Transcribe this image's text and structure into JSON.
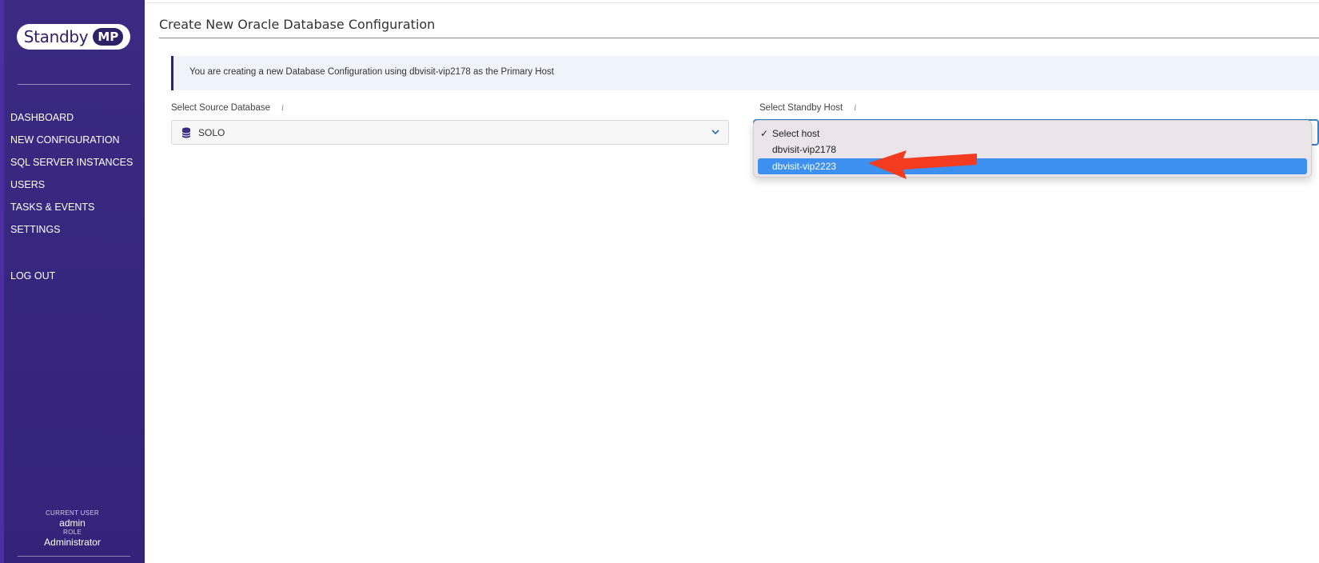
{
  "sidebar": {
    "logo": {
      "word": "Standby",
      "badge": "MP"
    },
    "items": [
      {
        "label": "DASHBOARD"
      },
      {
        "label": "NEW CONFIGURATION"
      },
      {
        "label": "SQL SERVER INSTANCES"
      },
      {
        "label": "USERS"
      },
      {
        "label": "TASKS & EVENTS"
      },
      {
        "label": "SETTINGS"
      }
    ],
    "logout_label": "LOG OUT",
    "user": {
      "current_user_caption": "CURRENT USER",
      "current_user": "admin",
      "role_caption": "ROLE",
      "role": "Administrator"
    }
  },
  "main": {
    "title": "Create New Oracle Database Configuration",
    "banner": "You are creating a new Database Configuration using dbvisit-vip2178 as the Primary Host",
    "source_db": {
      "label": "Select Source Database",
      "value": "SOLO",
      "icon": "database-icon"
    },
    "standby_host": {
      "label": "Select Standby Host",
      "options": [
        {
          "label": "Select host",
          "checked": true
        },
        {
          "label": "dbvisit-vip2178",
          "checked": false
        },
        {
          "label": "dbvisit-vip2223",
          "checked": false,
          "highlighted": true
        }
      ]
    }
  },
  "colors": {
    "sidebar_bg": "#3a2a82",
    "highlight": "#3d8ff0",
    "annotation_arrow": "#f23b1f"
  }
}
